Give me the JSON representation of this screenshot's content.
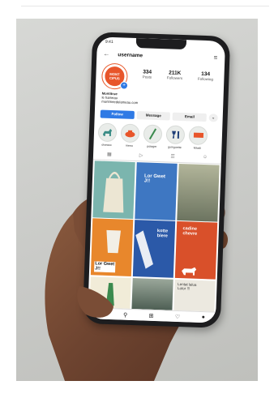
{
  "profile": {
    "username": "username",
    "logo_text": "MONT\nCIPUS",
    "stats": [
      {
        "value": "334",
        "label": "Posts"
      },
      {
        "value": "211K",
        "label": "Followers"
      },
      {
        "value": "134",
        "label": "Following"
      }
    ],
    "bio_name": "Montitrue",
    "bio_line2": "le hameau",
    "bio_line3": "montmeedelameau.com"
  },
  "buttons": {
    "follow": "Follow",
    "message": "Message",
    "email": "Email",
    "more": "⌄"
  },
  "highlights": [
    {
      "label": "oiseaux",
      "icon": "goat-icon",
      "color": "#3a8c86"
    },
    {
      "label": "menu",
      "icon": "teapot-icon",
      "color": "#e8552a"
    },
    {
      "label": "potager",
      "icon": "leaf-icon",
      "color": "#3b8a4e"
    },
    {
      "label": "guinguette",
      "icon": "wine-icon",
      "color": "#1f3f78"
    },
    {
      "label": "Miosli",
      "icon": "flag-icon",
      "color": "#e8552a"
    }
  ],
  "tiles": [
    {
      "caption": "",
      "bg": "#7bb5ae"
    },
    {
      "caption": "Lor Gwet J!!",
      "bg": "#3e77c2"
    },
    {
      "caption": "",
      "bg": "#8a8f72"
    },
    {
      "caption": "Lor Gwet J!!",
      "bg": "#e8872c"
    },
    {
      "caption": "kotte biere",
      "bg": "#2b59a8"
    },
    {
      "caption": "cadine chevre",
      "bg": "#d9502a"
    },
    {
      "caption": "",
      "bg": "#f1ecd8"
    },
    {
      "caption": "",
      "bg": "#5a6f62"
    },
    {
      "caption": "Lentat lalua Lotor !!!",
      "bg": "#ece9e0"
    }
  ],
  "colors": {
    "accent_blue": "#2f7ae5",
    "brand_orange": "#e8552a"
  }
}
